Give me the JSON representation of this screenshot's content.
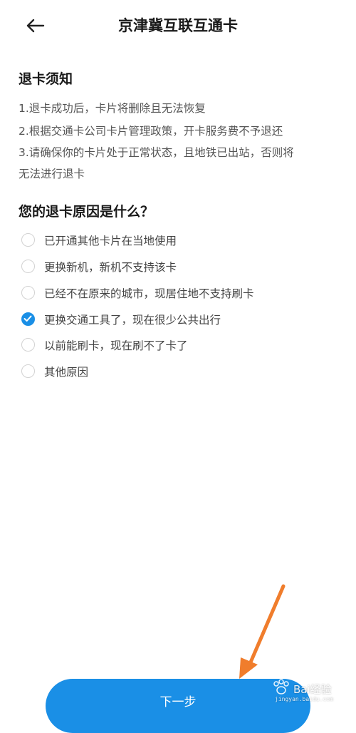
{
  "header": {
    "back_icon": "arrow-left-icon",
    "title": "京津冀互联互通卡"
  },
  "notice": {
    "title": "退卡须知",
    "lines": [
      "1.退卡成功后，卡片将删除且无法恢复",
      "2.根据交通卡公司卡片管理政策，开卡服务费不予退还",
      "3.请确保你的卡片处于正常状态，且地铁已出站，否则将",
      "无法进行退卡"
    ]
  },
  "question": {
    "title": "您的退卡原因是什么？",
    "options": [
      {
        "label": "已开通其他卡片在当地使用",
        "checked": false
      },
      {
        "label": "更换新机，新机不支持该卡",
        "checked": false
      },
      {
        "label": "已经不在原来的城市，现居住地不支持刷卡",
        "checked": false
      },
      {
        "label": "更换交通工具了，现在很少公共出行",
        "checked": true
      },
      {
        "label": "以前能刷卡，现在刷不了卡了",
        "checked": false
      },
      {
        "label": "其他原因",
        "checked": false
      }
    ]
  },
  "footer": {
    "next_label": "下一步"
  },
  "annotation": {
    "arrow_color": "#f07d2c"
  },
  "watermark": {
    "text": "Bai经验",
    "sub": "jingyan.baidu.com"
  },
  "colors": {
    "accent": "#1a8fe6",
    "text_primary": "#1a1a1a",
    "text_secondary": "#555555",
    "radio_border": "#d2d2d2"
  }
}
